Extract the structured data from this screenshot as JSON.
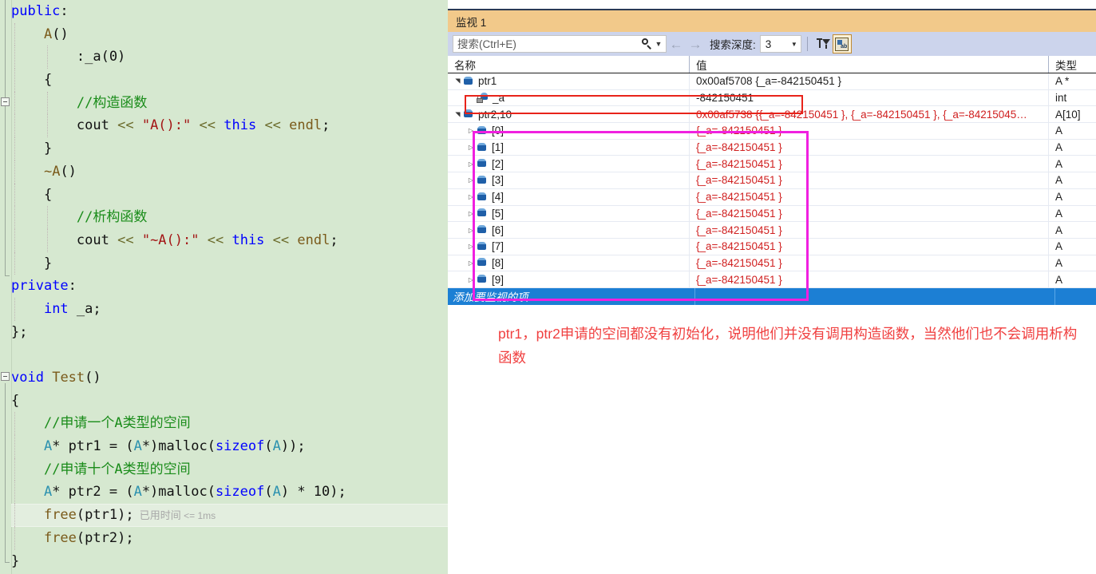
{
  "editor": {
    "language": "cpp",
    "lines": [
      {
        "id": "l1",
        "tokens": [
          {
            "t": "public",
            "c": "kw"
          },
          {
            "t": ":",
            "c": "pl"
          }
        ]
      },
      {
        "id": "l2",
        "tokens": [
          {
            "t": "    ",
            "c": "pl"
          },
          {
            "t": "A",
            "c": "fn"
          },
          {
            "t": "()",
            "c": "pl"
          }
        ]
      },
      {
        "id": "l3",
        "tokens": [
          {
            "t": "        :_a(0)",
            "c": "pl"
          }
        ]
      },
      {
        "id": "l4",
        "tokens": [
          {
            "t": "    {",
            "c": "pl"
          }
        ]
      },
      {
        "id": "l5",
        "tokens": [
          {
            "t": "        ",
            "c": "pl"
          },
          {
            "t": "//构造函数",
            "c": "cmt"
          }
        ]
      },
      {
        "id": "l6",
        "tokens": [
          {
            "t": "        ",
            "c": "pl"
          },
          {
            "t": "cout",
            "c": "pl"
          },
          {
            "t": " ",
            "c": "pl"
          },
          {
            "t": "<<",
            "c": "op"
          },
          {
            "t": " ",
            "c": "pl"
          },
          {
            "t": "\"A():\"",
            "c": "str"
          },
          {
            "t": " ",
            "c": "pl"
          },
          {
            "t": "<<",
            "c": "op"
          },
          {
            "t": " ",
            "c": "pl"
          },
          {
            "t": "this",
            "c": "kw"
          },
          {
            "t": " ",
            "c": "pl"
          },
          {
            "t": "<<",
            "c": "op"
          },
          {
            "t": " ",
            "c": "pl"
          },
          {
            "t": "endl",
            "c": "fn"
          },
          {
            "t": ";",
            "c": "pl"
          }
        ]
      },
      {
        "id": "l7",
        "tokens": [
          {
            "t": "    }",
            "c": "pl"
          }
        ]
      },
      {
        "id": "l8",
        "tokens": [
          {
            "t": "    ",
            "c": "pl"
          },
          {
            "t": "~A",
            "c": "fn"
          },
          {
            "t": "()",
            "c": "pl"
          }
        ]
      },
      {
        "id": "l9",
        "tokens": [
          {
            "t": "    {",
            "c": "pl"
          }
        ]
      },
      {
        "id": "l10",
        "tokens": [
          {
            "t": "        ",
            "c": "pl"
          },
          {
            "t": "//析构函数",
            "c": "cmt"
          }
        ]
      },
      {
        "id": "l11",
        "tokens": [
          {
            "t": "        ",
            "c": "pl"
          },
          {
            "t": "cout",
            "c": "pl"
          },
          {
            "t": " ",
            "c": "pl"
          },
          {
            "t": "<<",
            "c": "op"
          },
          {
            "t": " ",
            "c": "pl"
          },
          {
            "t": "\"~A():\"",
            "c": "str"
          },
          {
            "t": " ",
            "c": "pl"
          },
          {
            "t": "<<",
            "c": "op"
          },
          {
            "t": " ",
            "c": "pl"
          },
          {
            "t": "this",
            "c": "kw"
          },
          {
            "t": " ",
            "c": "pl"
          },
          {
            "t": "<<",
            "c": "op"
          },
          {
            "t": " ",
            "c": "pl"
          },
          {
            "t": "endl",
            "c": "fn"
          },
          {
            "t": ";",
            "c": "pl"
          }
        ]
      },
      {
        "id": "l12",
        "tokens": [
          {
            "t": "    }",
            "c": "pl"
          }
        ]
      },
      {
        "id": "l13",
        "tokens": [
          {
            "t": "private",
            "c": "kw"
          },
          {
            "t": ":",
            "c": "pl"
          }
        ]
      },
      {
        "id": "l14",
        "tokens": [
          {
            "t": "    ",
            "c": "pl"
          },
          {
            "t": "int",
            "c": "kw"
          },
          {
            "t": " _a;",
            "c": "pl"
          }
        ]
      },
      {
        "id": "l15",
        "tokens": [
          {
            "t": "};",
            "c": "pl"
          }
        ]
      },
      {
        "id": "l16",
        "tokens": []
      },
      {
        "id": "l17",
        "tokens": [
          {
            "t": "void",
            "c": "kw"
          },
          {
            "t": " ",
            "c": "pl"
          },
          {
            "t": "Test",
            "c": "fn"
          },
          {
            "t": "()",
            "c": "pl"
          }
        ]
      },
      {
        "id": "l18",
        "tokens": [
          {
            "t": "{",
            "c": "pl"
          }
        ]
      },
      {
        "id": "l19",
        "tokens": [
          {
            "t": "    ",
            "c": "pl"
          },
          {
            "t": "//申请一个A类型的空间",
            "c": "cmt"
          }
        ]
      },
      {
        "id": "l20",
        "tokens": [
          {
            "t": "    ",
            "c": "pl"
          },
          {
            "t": "A",
            "c": "typ"
          },
          {
            "t": "* ptr1 = (",
            "c": "pl"
          },
          {
            "t": "A",
            "c": "typ"
          },
          {
            "t": "*)malloc(",
            "c": "pl"
          },
          {
            "t": "sizeof",
            "c": "kw"
          },
          {
            "t": "(",
            "c": "pl"
          },
          {
            "t": "A",
            "c": "typ"
          },
          {
            "t": "));",
            "c": "pl"
          }
        ]
      },
      {
        "id": "l21",
        "tokens": [
          {
            "t": "    ",
            "c": "pl"
          },
          {
            "t": "//申请十个A类型的空间",
            "c": "cmt"
          }
        ]
      },
      {
        "id": "l22",
        "tokens": [
          {
            "t": "    ",
            "c": "pl"
          },
          {
            "t": "A",
            "c": "typ"
          },
          {
            "t": "* ptr2 = (",
            "c": "pl"
          },
          {
            "t": "A",
            "c": "typ"
          },
          {
            "t": "*)malloc(",
            "c": "pl"
          },
          {
            "t": "sizeof",
            "c": "kw"
          },
          {
            "t": "(",
            "c": "pl"
          },
          {
            "t": "A",
            "c": "typ"
          },
          {
            "t": ") * 10);",
            "c": "pl"
          }
        ]
      },
      {
        "id": "l23",
        "highlight": true,
        "tokens": [
          {
            "t": "    ",
            "c": "pl"
          },
          {
            "t": "free",
            "c": "fn"
          },
          {
            "t": "(ptr1);",
            "c": "pl"
          }
        ],
        "elapsed": "已用时间",
        "elapsed_value": "<= 1ms"
      },
      {
        "id": "l24",
        "tokens": [
          {
            "t": "    ",
            "c": "pl"
          },
          {
            "t": "free",
            "c": "fn"
          },
          {
            "t": "(ptr2);",
            "c": "pl"
          }
        ]
      },
      {
        "id": "l25",
        "tokens": [
          {
            "t": "}",
            "c": "pl"
          }
        ]
      }
    ]
  },
  "watch": {
    "title": "监视 1",
    "search": {
      "placeholder": "搜索(Ctrl+E)",
      "value": "",
      "icon": "search-icon",
      "dropdown_icon": "chevron-down-icon"
    },
    "nav": {
      "back_icon": "arrow-left-icon",
      "forward_icon": "arrow-right-icon"
    },
    "depth": {
      "label": "搜索深度:",
      "value": "3",
      "dropdown_icon": "chevron-down-icon"
    },
    "toolbar_buttons": [
      {
        "name": "filter-pin-button",
        "icon": "filter-pin-icon",
        "active": false
      },
      {
        "name": "hex-display-button",
        "icon": "hex-display-icon",
        "active": true
      }
    ],
    "columns": [
      "名称",
      "值",
      "类型"
    ],
    "rows": [
      {
        "indent": 0,
        "twisty": "expanded",
        "icon": "cube-icon",
        "name": "ptr1",
        "value": "0x00af5708 {_a=-842150451 }",
        "value_color": "black",
        "type": "A *"
      },
      {
        "indent": 1,
        "twisty": "none",
        "icon": "locked-cube-icon",
        "name": "_a",
        "value": "-842150451",
        "value_color": "black",
        "type": "int"
      },
      {
        "indent": 0,
        "twisty": "expanded",
        "icon": "cube-icon",
        "name": "ptr2,10",
        "value": "0x00af5738 {{_a=-842150451 }, {_a=-842150451 }, {_a=-84215045…",
        "value_color": "red",
        "type": "A[10]"
      },
      {
        "indent": 1,
        "twisty": "collapsed",
        "icon": "cube-icon",
        "name": "[0]",
        "value": "{_a=-842150451 }",
        "value_color": "red",
        "type": "A"
      },
      {
        "indent": 1,
        "twisty": "collapsed",
        "icon": "cube-icon",
        "name": "[1]",
        "value": "{_a=-842150451 }",
        "value_color": "red",
        "type": "A"
      },
      {
        "indent": 1,
        "twisty": "collapsed",
        "icon": "cube-icon",
        "name": "[2]",
        "value": "{_a=-842150451 }",
        "value_color": "red",
        "type": "A"
      },
      {
        "indent": 1,
        "twisty": "collapsed",
        "icon": "cube-icon",
        "name": "[3]",
        "value": "{_a=-842150451 }",
        "value_color": "red",
        "type": "A"
      },
      {
        "indent": 1,
        "twisty": "collapsed",
        "icon": "cube-icon",
        "name": "[4]",
        "value": "{_a=-842150451 }",
        "value_color": "red",
        "type": "A"
      },
      {
        "indent": 1,
        "twisty": "collapsed",
        "icon": "cube-icon",
        "name": "[5]",
        "value": "{_a=-842150451 }",
        "value_color": "red",
        "type": "A"
      },
      {
        "indent": 1,
        "twisty": "collapsed",
        "icon": "cube-icon",
        "name": "[6]",
        "value": "{_a=-842150451 }",
        "value_color": "red",
        "type": "A"
      },
      {
        "indent": 1,
        "twisty": "collapsed",
        "icon": "cube-icon",
        "name": "[7]",
        "value": "{_a=-842150451 }",
        "value_color": "red",
        "type": "A"
      },
      {
        "indent": 1,
        "twisty": "collapsed",
        "icon": "cube-icon",
        "name": "[8]",
        "value": "{_a=-842150451 }",
        "value_color": "red",
        "type": "A"
      },
      {
        "indent": 1,
        "twisty": "collapsed",
        "icon": "cube-icon",
        "name": "[9]",
        "value": "{_a=-842150451 }",
        "value_color": "red",
        "type": "A"
      }
    ],
    "add_row_label": "添加要监视的项"
  },
  "annotations": {
    "red_box_target": "_a",
    "pink_box_target": "ptr2 array elements [0]-[9]",
    "note": "ptr1，ptr2申请的空间都没有初始化，说明他们并没有调用构造函数，当然他们也不会调用析构函数"
  },
  "colors": {
    "editor_bg": "#d6e8d0",
    "watch_title_bg": "#f2c98a",
    "toolbar_bg": "#ccd4ec",
    "selected_row_bg": "#1c7fd4",
    "red_box": "#e8231a",
    "pink_box": "#f020e0",
    "annotation_text": "#f04040",
    "value_red": "#d02020"
  }
}
